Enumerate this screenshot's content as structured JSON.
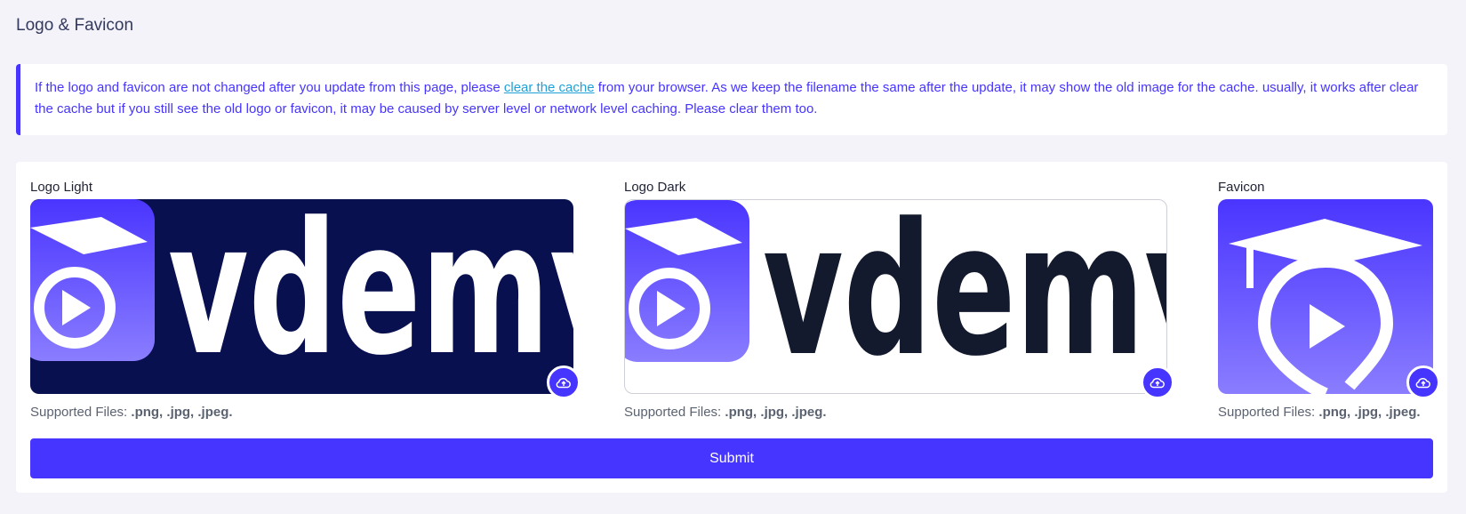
{
  "page": {
    "title": "Logo & Favicon"
  },
  "notice": {
    "text_before": "If the logo and favicon are not changed after you update from this page, please ",
    "link": "clear the cache",
    "text_after": " from your browser. As we keep the filename the same after the update, it may show the old image for the cache. usually, it works after clear the cache but if you still see the old logo or favicon, it may be caused by server level or network level caching. Please clear them too."
  },
  "fields": [
    {
      "label": "Logo Light",
      "hint_prefix": "Supported Files: ",
      "hint_types": ".png, .jpg, .jpeg.",
      "logo_text": "vdemy"
    },
    {
      "label": "Logo Dark",
      "hint_prefix": "Supported Files: ",
      "hint_types": ".png, .jpg, .jpeg.",
      "logo_text": "vdemy"
    },
    {
      "label": "Favicon",
      "hint_prefix": "Supported Files: ",
      "hint_types": ".png, .jpg, .jpeg."
    }
  ],
  "submit_label": "Submit",
  "colors": {
    "accent": "#4634ff",
    "link": "#1ea1d9",
    "logo_dark_bg": "#081050",
    "logo_dark_text": "#131a2e"
  },
  "icons": {
    "upload": "cloud-upload-icon",
    "logo_mark": "graduation-cap-play-icon"
  }
}
